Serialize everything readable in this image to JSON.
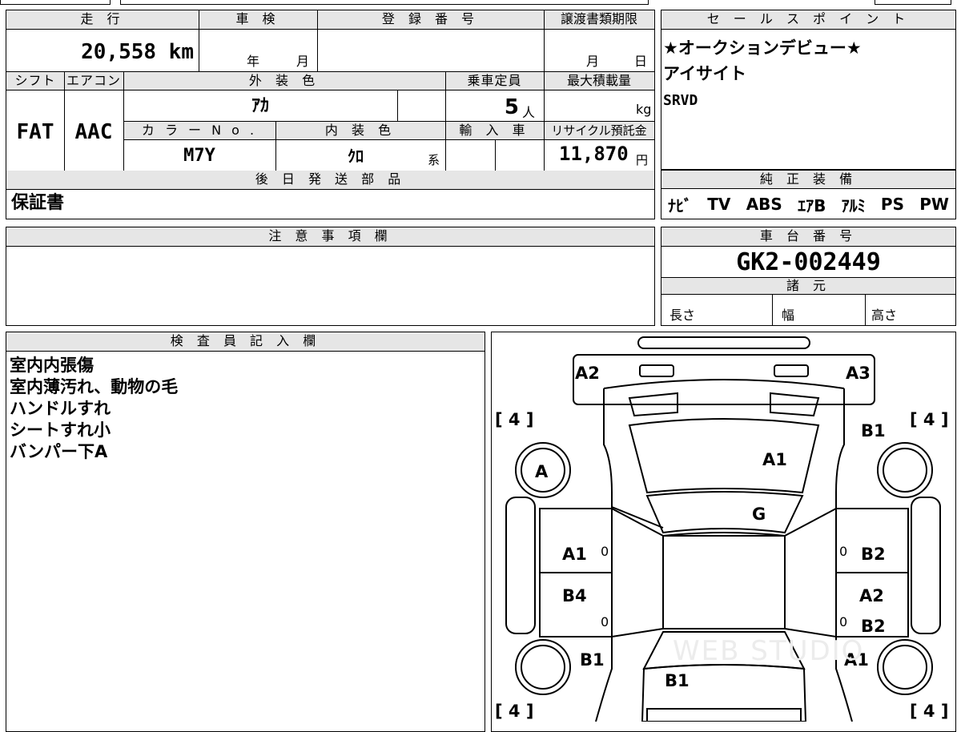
{
  "vehicle": {
    "header": {
      "mileage": "走 行",
      "inspection": "車 検",
      "registration": "登 録 番 号",
      "transfer_deadline": "譲渡書類期限",
      "shift": "シフト",
      "aircon": "エアコン",
      "exterior_color": "外 装 色",
      "capacity": "乗車定員",
      "max_load": "最大積載量",
      "color_no": "カ ラ ー N o .",
      "interior_color": "内 装 色",
      "import": "輸 入 車",
      "recycle_fee": "リサイクル預託金"
    },
    "mileage_value": "20,558 km",
    "inspection_year_label": "年",
    "inspection_month_label": "月",
    "transfer_month_label": "月",
    "transfer_day_label": "日",
    "shift_value": "FAT",
    "aircon_value": "AAC",
    "exterior_color_value": "ｱｶ",
    "capacity_value": "5",
    "capacity_unit": "人",
    "max_load_unit": "kg",
    "color_no_value": "M7Y",
    "interior_color_value": "ｸﾛ",
    "interior_color_suffix": "系",
    "recycle_fee_value": "11,870",
    "recycle_fee_unit": "円"
  },
  "later_shipping": {
    "header": "後 日 発 送 部 品",
    "value": "保証書"
  },
  "sales_points": {
    "header": "セ ー ル ス ポ イ ン ト",
    "lines": [
      "★オークションデビュー★",
      "アイサイト",
      "SRVD"
    ]
  },
  "equipment": {
    "header": "純 正 装 備",
    "items": [
      "ﾅﾋﾞ",
      "TV",
      "ABS",
      "ｴｱB",
      "ｱﾙﾐ",
      "PS",
      "PW"
    ]
  },
  "notes": {
    "header": "注 意 事 項 欄"
  },
  "chassis": {
    "header": "車 台 番 号",
    "value": "GK2-002449"
  },
  "specs": {
    "header": "諸 元",
    "length": "長さ",
    "width": "幅",
    "height": "高さ"
  },
  "inspector": {
    "header": "検 査 員 記 入 欄",
    "lines": [
      "室内内張傷",
      "室内薄汚れ、動物の毛",
      "ハンドルすれ",
      "シートすれ小",
      "バンパー下A"
    ]
  },
  "diagram": {
    "marks": {
      "a2": "A2",
      "a3": "A3",
      "tire_fl": "[ 4 ]",
      "tire_fr": "[ 4 ]",
      "tire_rl": "[ 4 ]",
      "tire_rr": "[ 4 ]",
      "b1_front_right": "B1",
      "a_front_left": "A",
      "a1_hood": "A1",
      "g_windshield": "G",
      "a1_left_front_door": "A1",
      "b2_right_front_door": "B2",
      "b4_left_rear_door": "B4",
      "a2_right_rear_door": "A2",
      "b2_right_rear_door": "B2",
      "b1_left_rear": "B1",
      "a1_right_rear": "A1",
      "b1_rear": "B1",
      "zero1": "0",
      "zero2": "0",
      "zero3": "0",
      "zero4": "0"
    },
    "watermark": "WEB STUDIO"
  }
}
